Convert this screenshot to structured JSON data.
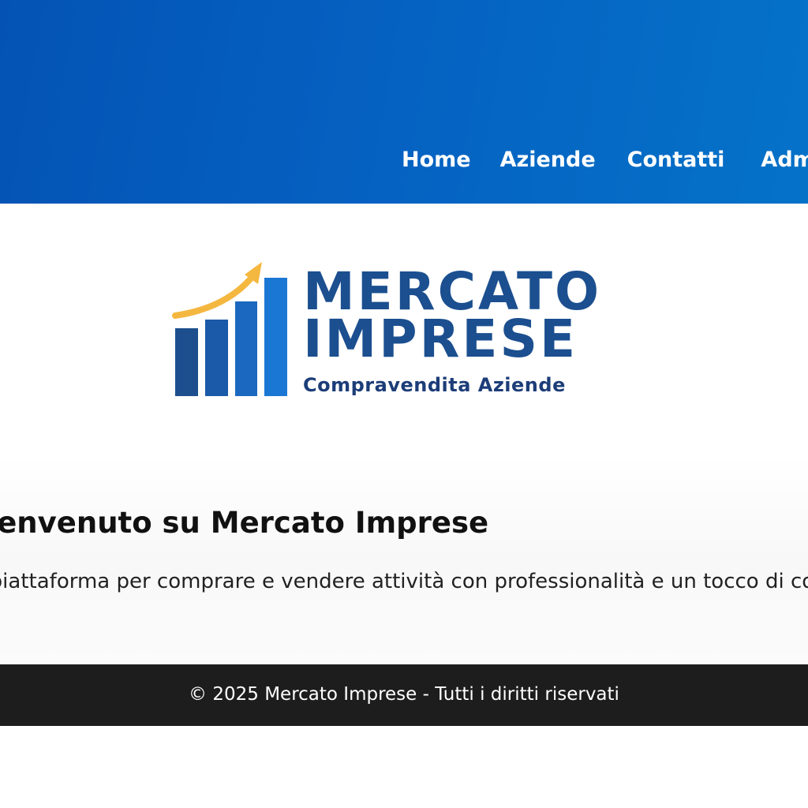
{
  "nav": {
    "items": [
      {
        "label": "Home"
      },
      {
        "label": "Aziende"
      },
      {
        "label": "Contatti"
      },
      {
        "label": "Admin"
      }
    ]
  },
  "logo": {
    "line1": "MERCATO",
    "line2": "IMPRESE",
    "tagline": "Compravendita Aziende",
    "icon": "bar-chart-growth-icon",
    "colors": {
      "bars": "#1c61b8",
      "arrow": "#f4b740",
      "text": "#1b4f8f"
    }
  },
  "welcome": {
    "title": "Benvenuto su Mercato Imprese",
    "text": "La piattaforma per comprare e vendere attività con professionalità e un tocco di colore."
  },
  "footer": {
    "text": "© 2025 Mercato Imprese - Tutti i diritti riservati"
  },
  "colors": {
    "header": "#0562c2",
    "footer": "#1d1d1d"
  }
}
